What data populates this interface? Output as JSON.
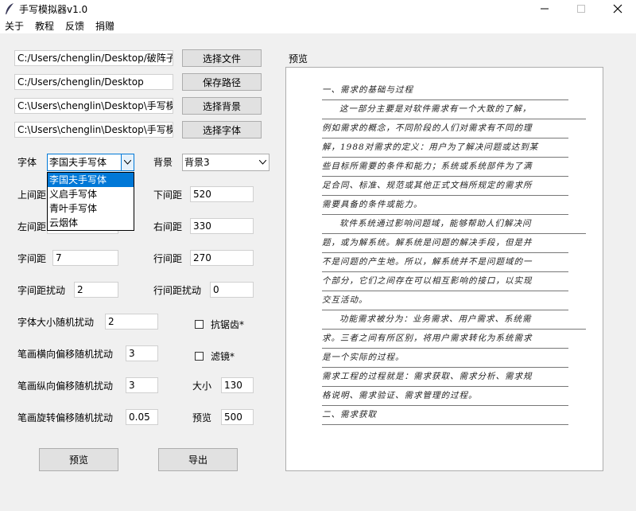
{
  "window": {
    "title": "手写模拟器v1.0",
    "minimize_icon": "minimize-icon",
    "maximize_icon": "maximize-icon",
    "close_icon": "close-icon"
  },
  "menu": {
    "items": [
      "关于",
      "教程",
      "反馈",
      "捐赠"
    ]
  },
  "paths": [
    {
      "value": "C:/Users/chenglin/Desktop/破阵子",
      "button": "选择文件"
    },
    {
      "value": "C:/Users/chenglin/Desktop",
      "button": "保存路径"
    },
    {
      "value": "C:\\Users\\chenglin\\Desktop\\手写模",
      "button": "选择背景"
    },
    {
      "value": "C:\\Users\\chenglin\\Desktop\\手写模",
      "button": "选择字体"
    }
  ],
  "font": {
    "label": "字体",
    "selected": "李国夫手写体",
    "options": [
      "李国夫手写体",
      "义启手写体",
      "青叶手写体",
      "云烟体"
    ]
  },
  "background": {
    "label": "背景",
    "selected": "背景3"
  },
  "params": {
    "top_margin": {
      "label": "上间距",
      "value": ""
    },
    "bottom_margin": {
      "label": "下间距",
      "value": "520"
    },
    "left_margin": {
      "label": "左间距",
      "value": ""
    },
    "right_margin": {
      "label": "右间距",
      "value": "330"
    },
    "char_spacing": {
      "label": "字间距",
      "value": "7"
    },
    "line_spacing": {
      "label": "行间距",
      "value": "270"
    },
    "char_spacing_jitter": {
      "label": "字间距扰动",
      "value": "2"
    },
    "line_spacing_jitter": {
      "label": "行间距扰动",
      "value": "0"
    },
    "font_size_jitter": {
      "label": "字体大小随机扰动",
      "value": "2"
    },
    "stroke_h_jitter": {
      "label": "笔画横向偏移随机扰动",
      "value": "3"
    },
    "stroke_v_jitter": {
      "label": "笔画纵向偏移随机扰动",
      "value": "3"
    },
    "stroke_rot_jitter": {
      "label": "笔画旋转偏移随机扰动",
      "value": "0.05"
    },
    "size": {
      "label": "大小",
      "value": "130"
    },
    "preview_size": {
      "label": "预览",
      "value": "500"
    }
  },
  "options": {
    "antialias": {
      "label": "抗锯齿*",
      "checked": false
    },
    "filter": {
      "label": "滤镜*",
      "checked": false
    }
  },
  "actions": {
    "preview": "预览",
    "export": "导出"
  },
  "preview": {
    "label": "预览",
    "lines": [
      "一、需求的基础与过程",
      "这一部分主要是对软件需求有一个大致的了解，",
      "例如需求的概念，不同阶段的人们对需求有不同的理",
      "解，1988对需求的定义：用户为了解决问题或达到某",
      "些目标所需要的条件和能力；系统或系统部件为了满",
      "足合同、标准、规范或其他正式文档所规定的需求所",
      "需要具备的条件或能力。",
      "软件系统通过影响问题域，能够帮助人们解决问",
      "题，或为解系统。解系统是问题的解决手段，但是并",
      "不是问题的产生地。所以，解系统并不是问题域的一",
      "个部分，它们之间存在可以相互影响的接口，以实现",
      "交互活动。",
      "功能需求被分为：业务需求、用户需求、系统需",
      "求。三者之间有所区别，将用户需求转化为系统需求",
      "是一个实际的过程。",
      "需求工程的过程就是：需求获取、需求分析、需求规",
      "格说明、需求验证、需求管理的过程。",
      "二、需求获取"
    ]
  }
}
